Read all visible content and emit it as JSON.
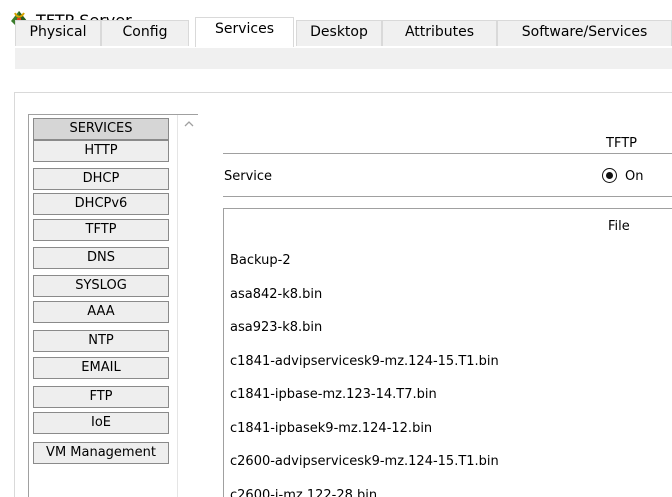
{
  "window": {
    "title": "TFTP Server",
    "icon": "tftp-server-icon"
  },
  "tabs": [
    {
      "label": "Physical",
      "active": false
    },
    {
      "label": "Config",
      "active": false
    },
    {
      "label": "Services",
      "active": true
    },
    {
      "label": "Desktop",
      "active": false
    },
    {
      "label": "Attributes",
      "active": false
    },
    {
      "label": "Software/Services",
      "active": false
    }
  ],
  "services": {
    "header": "SERVICES",
    "items": [
      "HTTP",
      "DHCP",
      "DHCPv6",
      "TFTP",
      "DNS",
      "SYSLOG",
      "AAA",
      "NTP",
      "EMAIL",
      "FTP",
      "IoE",
      "VM Management"
    ]
  },
  "tftp": {
    "heading": "TFTP",
    "service_label": "Service",
    "on_label": "On",
    "file_header": "File",
    "files": [
      "Backup-2",
      "asa842-k8.bin",
      "asa923-k8.bin",
      "c1841-advipservicesk9-mz.124-15.T1.bin",
      "c1841-ipbase-mz.123-14.T7.bin",
      "c1841-ipbasek9-mz.124-12.bin",
      "c2600-advipservicesk9-mz.124-15.T1.bin",
      "c2600-i-mz.122-28.bin"
    ]
  }
}
